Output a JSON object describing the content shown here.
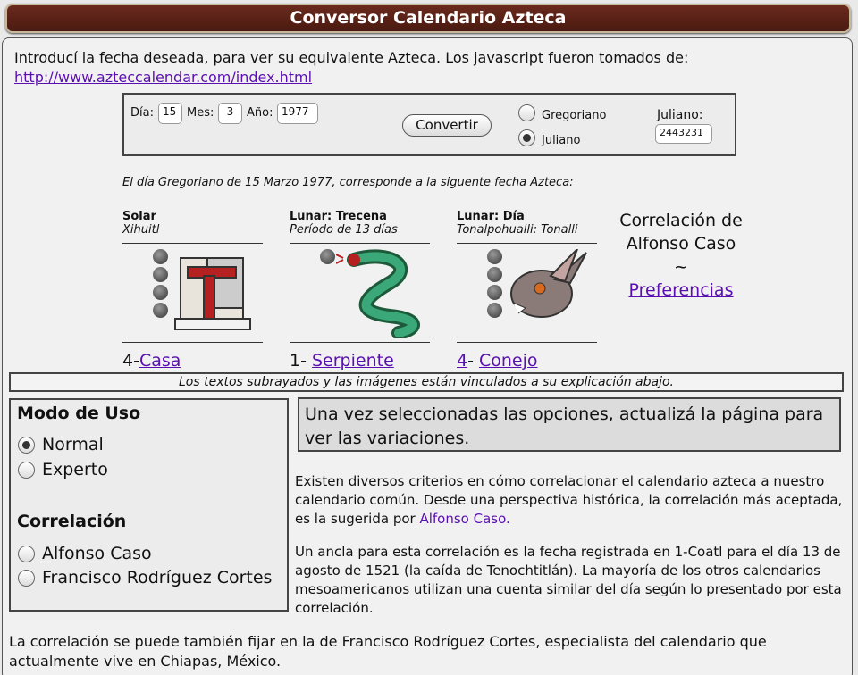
{
  "header": {
    "title": "Conversor Calendario Azteca"
  },
  "intro": {
    "text": "Introducí la fecha deseada, para ver su equivalente Azteca. Los javascript fueron tomados de:",
    "link": "http://www.aztеccalendar.com/index.html"
  },
  "form": {
    "day_label": "Día:",
    "day_value": "15",
    "month_label": "Mes:",
    "month_value": "3",
    "year_label": "Año:",
    "year_value": "1977",
    "convert_label": "Convertir",
    "opt_gregoriano": "Gregoriano",
    "opt_juliano": "Juliano",
    "selected": "Juliano",
    "julian_label": "Juliano:",
    "julian_value": "2443231"
  },
  "result": "El día Gregoriano de 15 Marzo 1977, corresponde a la siguente fecha Azteca:",
  "columns": [
    {
      "heading": "Solar",
      "sub": "Xihuitl",
      "num": "4-",
      "name": "Casa",
      "icon": "casa-glyph-icon"
    },
    {
      "heading": "Lunar: Trecena",
      "sub": "Período de 13 días",
      "num": "1- ",
      "name": "Serpiente",
      "icon": "serpiente-glyph-icon"
    },
    {
      "heading": "Lunar: Día",
      "sub": "Tonalpohualli: Tonalli",
      "num": "4",
      "num_sep": "- ",
      "name": "Conejo",
      "icon": "conejo-glyph-icon"
    }
  ],
  "correlation": {
    "text": "Correlación de Alfonso Caso ~",
    "link": "Preferencias"
  },
  "note": "Los textos subrayados y las imágenes están vinculados a su explicación abajo.",
  "mode": {
    "title": "Modo de Uso",
    "options": [
      "Normal",
      "Experto"
    ],
    "selected": "Normal",
    "corr_title": "Correlación",
    "corr_options": [
      "Alfonso Caso",
      "Francisco Rodríguez Cortes"
    ]
  },
  "tip": "Una vez seleccionadas las opciones, actualizá la página para ver las variaciones.",
  "para1": "Existen diversos criterios en cómo correlacionar el calendario azteca a nuestro calendario común. Desde una perspectiva histórica, la correlación más aceptada, es la sugerida por ",
  "para1_link": "Alfonso Caso.",
  "para2": "Un ancla para esta correlación es la fecha registrada en 1-Coatl para el día 13 de agosto de 1521 (la caída de Tenochtitlán). La mayoría de los otros calendarios mesoamericanos utilizan una cuenta similar del día según lo presentado por esta correlación.",
  "bottom": "La correlación se puede también fijar en la de Francisco Rodríguez Cortes, especialista del calendario que actualmente vive en Chiapas, México.",
  "colors": {
    "title_bg": "#5a2216",
    "link": "#5a10b0"
  }
}
